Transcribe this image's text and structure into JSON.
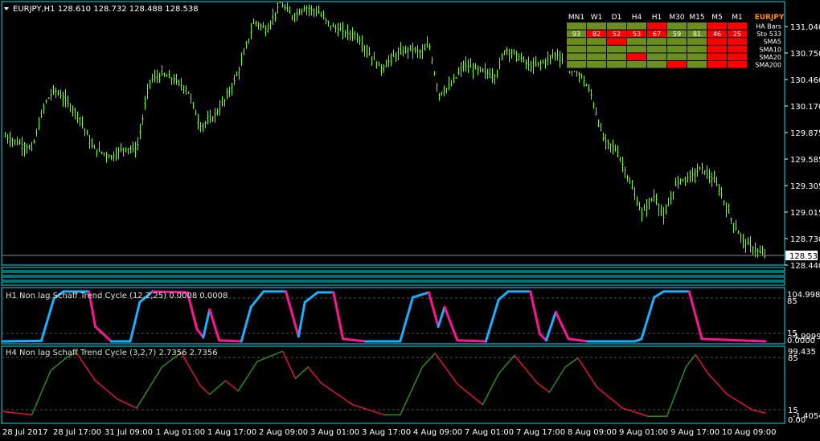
{
  "main": {
    "header": "EURJPY,H1  128.610 128.732 128.488 128.538",
    "price_labels": [
      "131.040",
      "130.750",
      "130.460",
      "130.170",
      "129.875",
      "129.585",
      "129.305",
      "129.015",
      "128.730",
      "128.440"
    ],
    "current_price": "128.538"
  },
  "dashboard": {
    "columns": [
      "MN1",
      "W1",
      "D1",
      "H4",
      "H1",
      "M30",
      "M15",
      "M5",
      "M1"
    ],
    "symbol": "EURJPY",
    "rows": [
      {
        "label": "HA Bars",
        "cells": [
          {
            "c": "g",
            "v": ""
          },
          {
            "c": "g",
            "v": ""
          },
          {
            "c": "g",
            "v": ""
          },
          {
            "c": "g",
            "v": ""
          },
          {
            "c": "r",
            "v": ""
          },
          {
            "c": "g",
            "v": ""
          },
          {
            "c": "g",
            "v": ""
          },
          {
            "c": "r",
            "v": ""
          },
          {
            "c": "r",
            "v": ""
          }
        ]
      },
      {
        "label": "Sto 533",
        "cells": [
          {
            "c": "g",
            "v": "93"
          },
          {
            "c": "r",
            "v": "82"
          },
          {
            "c": "r",
            "v": "52"
          },
          {
            "c": "r",
            "v": "53"
          },
          {
            "c": "r",
            "v": "67"
          },
          {
            "c": "g",
            "v": "59"
          },
          {
            "c": "g",
            "v": "81"
          },
          {
            "c": "r",
            "v": "46"
          },
          {
            "c": "r",
            "v": "25"
          }
        ]
      },
      {
        "label": "SMA5",
        "cells": [
          {
            "c": "g",
            "v": ""
          },
          {
            "c": "g",
            "v": ""
          },
          {
            "c": "r",
            "v": ""
          },
          {
            "c": "g",
            "v": ""
          },
          {
            "c": "g",
            "v": ""
          },
          {
            "c": "g",
            "v": ""
          },
          {
            "c": "g",
            "v": ""
          },
          {
            "c": "r",
            "v": ""
          },
          {
            "c": "r",
            "v": ""
          }
        ]
      },
      {
        "label": "SMA10",
        "cells": [
          {
            "c": "g",
            "v": ""
          },
          {
            "c": "g",
            "v": ""
          },
          {
            "c": "g",
            "v": ""
          },
          {
            "c": "g",
            "v": ""
          },
          {
            "c": "g",
            "v": ""
          },
          {
            "c": "g",
            "v": ""
          },
          {
            "c": "g",
            "v": ""
          },
          {
            "c": "r",
            "v": ""
          },
          {
            "c": "r",
            "v": ""
          }
        ]
      },
      {
        "label": "SMA20",
        "cells": [
          {
            "c": "g",
            "v": ""
          },
          {
            "c": "g",
            "v": ""
          },
          {
            "c": "g",
            "v": ""
          },
          {
            "c": "r",
            "v": ""
          },
          {
            "c": "g",
            "v": ""
          },
          {
            "c": "g",
            "v": ""
          },
          {
            "c": "g",
            "v": ""
          },
          {
            "c": "r",
            "v": ""
          },
          {
            "c": "r",
            "v": ""
          }
        ]
      },
      {
        "label": "SMA200",
        "cells": [
          {
            "c": "g",
            "v": ""
          },
          {
            "c": "g",
            "v": ""
          },
          {
            "c": "g",
            "v": ""
          },
          {
            "c": "g",
            "v": ""
          },
          {
            "c": "g",
            "v": ""
          },
          {
            "c": "r",
            "v": ""
          },
          {
            "c": "g",
            "v": ""
          },
          {
            "c": "r",
            "v": ""
          },
          {
            "c": "r",
            "v": ""
          }
        ]
      }
    ]
  },
  "indicator1": {
    "label": "H1 Non lag Schaff Trend Cycle  (12,2,25) 0.0008 0.0008",
    "scale_labels": [
      "104.9984",
      "85",
      "15",
      "0.0000",
      "-4.9999"
    ]
  },
  "indicator2": {
    "label": "H4 Non lag Schaff Trend Cycle  (3,2,7) 2.7356 2.7356",
    "scale_labels": [
      "99.435",
      "85",
      "15",
      "0.00",
      "-1.4054"
    ]
  },
  "time_axis": [
    "28 Jul 2017",
    "28 Jul 17:00",
    "31 Jul 09:00",
    "1 Aug 01:00",
    "1 Aug 17:00",
    "2 Aug 09:00",
    "3 Aug 01:00",
    "3 Aug 17:00",
    "4 Aug 09:00",
    "7 Aug 01:00",
    "7 Aug 17:00",
    "8 Aug 09:00",
    "9 Aug 01:00",
    "9 Aug 17:00",
    "10 Aug 09:00"
  ],
  "colors": {
    "background": "#000000",
    "frame": "#00e5ee",
    "candle": "#7cfc00",
    "dashboard_green": "#6b8e23",
    "dashboard_red": "#ff0000",
    "stc_up": "#1ab0ff",
    "stc_down": "#ff1493",
    "h4_up": "#2e8b1e",
    "h4_down": "#dc143c"
  },
  "chart_data": [
    {
      "type": "candlestick",
      "title": "EURJPY,H1",
      "ylim": [
        128.44,
        131.04
      ],
      "close_path": [
        [
          "27 Jul 17:00",
          129.85
        ],
        [
          "28 Jul 02:00",
          129.7
        ],
        [
          "28 Jul 06:00",
          130.2
        ],
        [
          "28 Jul 09:00",
          130.35
        ],
        [
          "28 Jul 13:00",
          130.22
        ],
        [
          "28 Jul 17:00",
          130.05
        ],
        [
          "28 Jul 21:00",
          129.72
        ],
        [
          "31 Jul 03:00",
          129.62
        ],
        [
          "31 Jul 07:00",
          129.72
        ],
        [
          "31 Jul 11:00",
          129.7
        ],
        [
          "31 Jul 15:00",
          130.45
        ],
        [
          "31 Jul 19:00",
          130.52
        ],
        [
          "31 Jul 23:00",
          130.45
        ],
        [
          "1 Aug 03:00",
          130.35
        ],
        [
          "1 Aug 07:00",
          129.95
        ],
        [
          "1 Aug 11:00",
          130.05
        ],
        [
          "1 Aug 15:00",
          130.25
        ],
        [
          "1 Aug 19:00",
          130.55
        ],
        [
          "2 Aug 00:00",
          131.1
        ],
        [
          "2 Aug 04:00",
          131.0
        ],
        [
          "2 Aug 08:00",
          131.3
        ],
        [
          "2 Aug 12:00",
          131.15
        ],
        [
          "2 Aug 16:00",
          131.25
        ],
        [
          "2 Aug 20:00",
          131.2
        ],
        [
          "3 Aug 00:00",
          131.05
        ],
        [
          "3 Aug 04:00",
          130.98
        ],
        [
          "3 Aug 08:00",
          130.95
        ],
        [
          "3 Aug 12:00",
          130.75
        ],
        [
          "3 Aug 16:00",
          130.58
        ],
        [
          "3 Aug 20:00",
          130.72
        ],
        [
          "4 Aug 01:00",
          130.8
        ],
        [
          "4 Aug 05:00",
          130.75
        ],
        [
          "4 Aug 07:00",
          130.85
        ],
        [
          "4 Aug 10:00",
          130.3
        ],
        [
          "4 Aug 14:00",
          130.4
        ],
        [
          "4 Aug 18:00",
          130.62
        ],
        [
          "7 Aug 00:00",
          130.55
        ],
        [
          "7 Aug 04:00",
          130.5
        ],
        [
          "7 Aug 07:00",
          130.8
        ],
        [
          "7 Aug 11:00",
          130.72
        ],
        [
          "7 Aug 15:00",
          130.6
        ],
        [
          "7 Aug 19:00",
          130.65
        ],
        [
          "7 Aug 23:00",
          130.75
        ],
        [
          "8 Aug 03:00",
          130.6
        ],
        [
          "8 Aug 07:00",
          130.5
        ],
        [
          "8 Aug 10:00",
          130.3
        ],
        [
          "8 Aug 14:00",
          129.8
        ],
        [
          "8 Aug 18:00",
          129.7
        ],
        [
          "8 Aug 21:00",
          129.45
        ],
        [
          "9 Aug 02:00",
          129.0
        ],
        [
          "9 Aug 06:00",
          129.2
        ],
        [
          "9 Aug 09:00",
          128.95
        ],
        [
          "9 Aug 13:00",
          129.35
        ],
        [
          "9 Aug 17:00",
          129.4
        ],
        [
          "9 Aug 21:00",
          129.5
        ],
        [
          "10 Aug 02:00",
          129.3
        ],
        [
          "10 Aug 06:00",
          128.95
        ],
        [
          "10 Aug 10:00",
          128.7
        ],
        [
          "10 Aug 14:00",
          128.6
        ],
        [
          "10 Aug 17:00",
          128.54
        ]
      ]
    },
    {
      "type": "line",
      "title": "H1 Non lag Schaff Trend Cycle",
      "ylim": [
        -4.9999,
        104.9984
      ],
      "series": [
        {
          "name": "H1 Non lag Schaff Trend Cycle",
          "points": [
            [
              "27 Jul 17:00",
              0
            ],
            [
              "28 Jul 05:00",
              1
            ],
            [
              "28 Jul 09:00",
              88
            ],
            [
              "28 Jul 12:00",
              102
            ],
            [
              "28 Jul 20:00",
              102
            ],
            [
              "28 Jul 22:00",
              30
            ],
            [
              "31 Jul 03:00",
              0
            ],
            [
              "31 Jul 09:00",
              0
            ],
            [
              "31 Jul 12:00",
              80
            ],
            [
              "31 Jul 16:00",
              102
            ],
            [
              "1 Aug 03:00",
              100
            ],
            [
              "1 Aug 06:00",
              25
            ],
            [
              "1 Aug 08:00",
              8
            ],
            [
              "1 Aug 10:00",
              65
            ],
            [
              "1 Aug 13:00",
              2
            ],
            [
              "1 Aug 20:00",
              0
            ],
            [
              "1 Aug 23:00",
              70
            ],
            [
              "2 Aug 03:00",
              102
            ],
            [
              "2 Aug 10:00",
              102
            ],
            [
              "2 Aug 14:00",
              10
            ],
            [
              "2 Aug 16:00",
              80
            ],
            [
              "2 Aug 20:00",
              100
            ],
            [
              "3 Aug 01:00",
              100
            ],
            [
              "3 Aug 04:00",
              5
            ],
            [
              "3 Aug 11:00",
              0
            ],
            [
              "3 Aug 22:00",
              0
            ],
            [
              "4 Aug 02:00",
              90
            ],
            [
              "4 Aug 07:00",
              100
            ],
            [
              "4 Aug 10:00",
              30
            ],
            [
              "4 Aug 12:00",
              70
            ],
            [
              "4 Aug 16:00",
              2
            ],
            [
              "7 Aug 01:00",
              0
            ],
            [
              "7 Aug 05:00",
              85
            ],
            [
              "7 Aug 08:00",
              102
            ],
            [
              "7 Aug 15:00",
              102
            ],
            [
              "7 Aug 18:00",
              15
            ],
            [
              "7 Aug 20:00",
              2
            ],
            [
              "7 Aug 23:00",
              60
            ],
            [
              "8 Aug 03:00",
              5
            ],
            [
              "8 Aug 09:00",
              0
            ],
            [
              "9 Aug 00:00",
              0
            ],
            [
              "9 Aug 02:00",
              5
            ],
            [
              "9 Aug 06:00",
              90
            ],
            [
              "9 Aug 09:00",
              102
            ],
            [
              "9 Aug 17:00",
              102
            ],
            [
              "9 Aug 21:00",
              5
            ],
            [
              "10 Aug 17:00",
              0
            ]
          ]
        }
      ]
    },
    {
      "type": "line",
      "title": "H4 Non lag Schaff Trend Cycle",
      "ylim": [
        -1.4054,
        99.435
      ],
      "series": [
        {
          "name": "H4 Non lag Schaff Trend Cycle",
          "points": [
            [
              "27 Jul 17:00",
              10
            ],
            [
              "28 Jul 02:00",
              5
            ],
            [
              "28 Jul 08:00",
              70
            ],
            [
              "28 Jul 13:00",
              89
            ],
            [
              "28 Jul 16:00",
              96
            ],
            [
              "28 Jul 22:00",
              55
            ],
            [
              "31 Jul 05:00",
              28
            ],
            [
              "31 Jul 11:00",
              15
            ],
            [
              "31 Jul 19:00",
              75
            ],
            [
              "1 Aug 01:00",
              96
            ],
            [
              "1 Aug 07:00",
              48
            ],
            [
              "1 Aug 10:00",
              35
            ],
            [
              "1 Aug 15:00",
              55
            ],
            [
              "1 Aug 19:00",
              40
            ],
            [
              "2 Aug 01:00",
              83
            ],
            [
              "2 Aug 09:00",
              98
            ],
            [
              "2 Aug 13:00",
              58
            ],
            [
              "2 Aug 17:00",
              75
            ],
            [
              "2 Aug 21:00",
              52
            ],
            [
              "3 Aug 07:00",
              20
            ],
            [
              "3 Aug 17:00",
              5
            ],
            [
              "3 Aug 22:00",
              5
            ],
            [
              "4 Aug 05:00",
              75
            ],
            [
              "4 Aug 09:00",
              95
            ],
            [
              "4 Aug 16:00",
              50
            ],
            [
              "7 Aug 00:00",
              20
            ],
            [
              "7 Aug 05:00",
              65
            ],
            [
              "7 Aug 10:00",
              92
            ],
            [
              "7 Aug 17:00",
              52
            ],
            [
              "7 Aug 21:00",
              38
            ],
            [
              "8 Aug 02:00",
              75
            ],
            [
              "8 Aug 06:00",
              88
            ],
            [
              "8 Aug 12:00",
              45
            ],
            [
              "8 Aug 20:00",
              15
            ],
            [
              "9 Aug 04:00",
              3
            ],
            [
              "9 Aug 10:00",
              3
            ],
            [
              "9 Aug 16:00",
              75
            ],
            [
              "9 Aug 19:00",
              93
            ],
            [
              "9 Aug 23:00",
              65
            ],
            [
              "10 Aug 05:00",
              35
            ],
            [
              "10 Aug 13:00",
              12
            ],
            [
              "10 Aug 17:00",
              8
            ]
          ]
        }
      ]
    }
  ]
}
